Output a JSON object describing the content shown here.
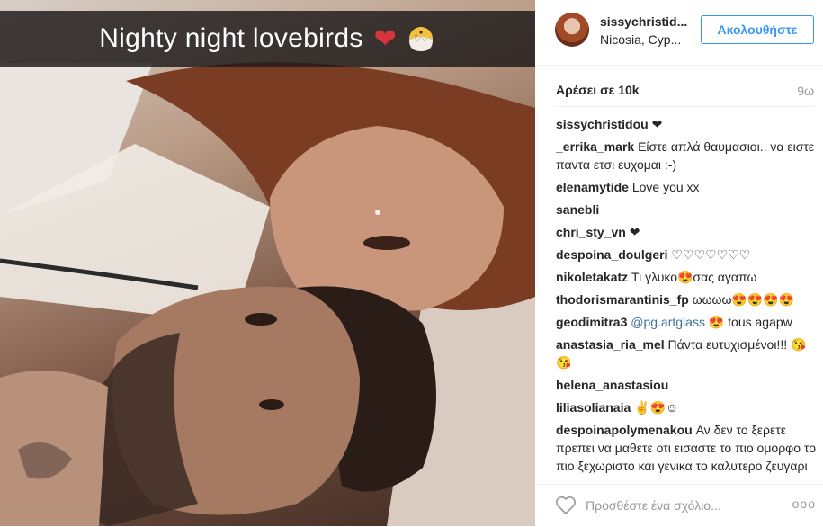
{
  "photo": {
    "caption": "Nighty night lovebirds",
    "caption_heart": "❤",
    "caption_emoji_icon": "hatching-chick-icon"
  },
  "post_header": {
    "username": "sissychristid...",
    "location": "Nicosia, Cyp...",
    "follow_label": "Ακολουθήστε"
  },
  "stats": {
    "likes": "Αρέσει σε 10k",
    "time": "9ω"
  },
  "comments": [
    {
      "user": "sissychristidou",
      "text": "❤"
    },
    {
      "user": "_errika_mark",
      "text": "Είστε απλά θαυμασιοι.. να ειστε παντα ετσι ευχομαι :-)"
    },
    {
      "user": "elenamytide",
      "text": "Love you xx"
    },
    {
      "user": "sanebli",
      "text": ""
    },
    {
      "user": "chri_sty_vn",
      "text": "❤"
    },
    {
      "user": "despoina_doulgeri",
      "text": "♡♡♡♡♡♡♡"
    },
    {
      "user": "nikoletakatz",
      "text": "Τι γλυκο😍σας αγαπω"
    },
    {
      "user": "thodorismarantinis_fp",
      "text": "ωωωω😍😍😍😍"
    },
    {
      "user": "geodimitra3",
      "mention": "@pg.artglass",
      "text": "😍 tous agapw"
    },
    {
      "user": "anastasia_ria_mel",
      "text": "Πάντα ευτυχισμένοι!!! 😘😘"
    },
    {
      "user": "helena_anastasiou",
      "text": ""
    },
    {
      "user": "liliasolianaia",
      "text": "✌😍☺"
    },
    {
      "user": "despoinapolymenakou",
      "text": "Αν δεν το ξερετε πρεπει να μαθετε οτι εισαστε το πιο ομορφο το πιο ξεχωριστο και γενικα το καλυτερο ζευγαρι που υπαρχει!! Σας"
    }
  ],
  "footer": {
    "comment_placeholder": "Προσθέστε ένα σχόλιο...",
    "more_label": "ooo"
  },
  "colors": {
    "accent": "#3897f0",
    "text": "#262626",
    "muted": "#999999"
  }
}
